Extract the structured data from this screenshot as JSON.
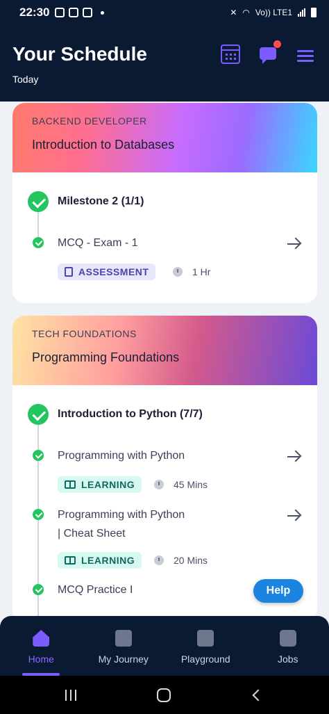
{
  "status": {
    "time": "22:30",
    "network": "Vo)) LTE1"
  },
  "header": {
    "title": "Your Schedule",
    "subtitle": "Today"
  },
  "cards": [
    {
      "category": "BACKEND DEVELOPER",
      "title": "Introduction to Databases",
      "milestone": "Milestone 2 (1/1)",
      "items": [
        {
          "title": "MCQ - Exam - 1",
          "tag": "ASSESSMENT",
          "duration": "1 Hr"
        }
      ]
    },
    {
      "category": "TECH FOUNDATIONS",
      "title": "Programming Foundations",
      "milestone": "Introduction to Python (7/7)",
      "items": [
        {
          "title": "Programming with Python",
          "tag": "LEARNING",
          "duration": "45 Mins"
        },
        {
          "title": "Programming with Python",
          "title_line2": "| Cheat Sheet",
          "tag": "LEARNING",
          "duration": "20 Mins"
        },
        {
          "title": "MCQ Practice I"
        }
      ]
    }
  ],
  "help_label": "Help",
  "nav": [
    {
      "label": "Home",
      "icon": "home-icon",
      "active": true
    },
    {
      "label": "My Journey",
      "icon": "flag-icon"
    },
    {
      "label": "Playground",
      "icon": "terminal-icon"
    },
    {
      "label": "Jobs",
      "icon": "briefcase-icon"
    }
  ],
  "colors": {
    "header_bg": "#0b1a33",
    "accent": "#7c5cff",
    "check": "#22c55e",
    "help": "#1a84e0"
  }
}
